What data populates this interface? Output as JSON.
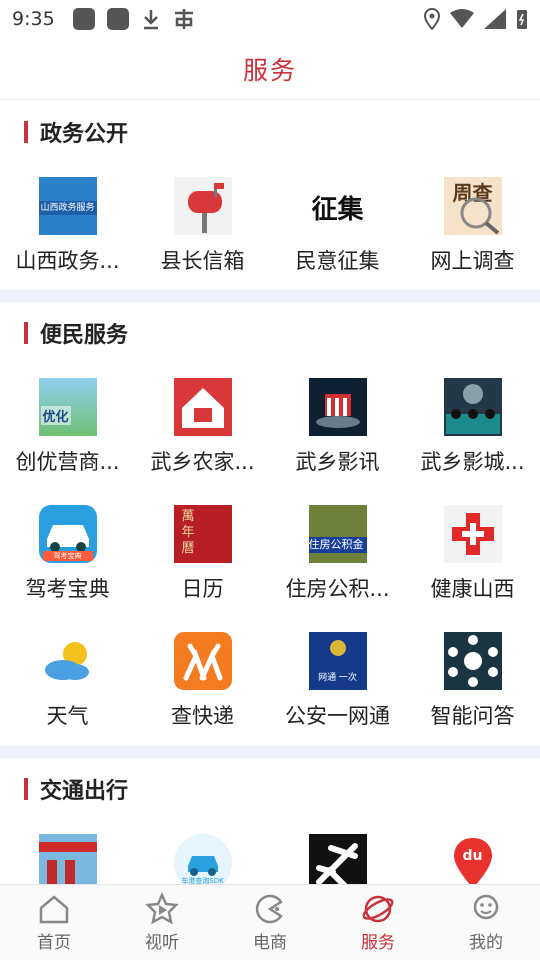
{
  "status": {
    "time": "9:35"
  },
  "header": {
    "title": "服务"
  },
  "sections": [
    {
      "title": "政务公开",
      "items": [
        {
          "label": "山西政务...",
          "icon": "shanxi-gov-icon",
          "art": "山西政务服务"
        },
        {
          "label": "县长信箱",
          "icon": "mailbox-icon"
        },
        {
          "label": "民意征集",
          "icon": "opinion-collect-icon",
          "art": "征集"
        },
        {
          "label": "网上调查",
          "icon": "survey-icon",
          "art": "周查"
        }
      ]
    },
    {
      "title": "便民服务",
      "items": [
        {
          "label": "创优营商...",
          "icon": "business-env-icon",
          "art": "优化"
        },
        {
          "label": "武乡农家...",
          "icon": "farmhouse-icon"
        },
        {
          "label": "武乡影讯",
          "icon": "movie-news-icon"
        },
        {
          "label": "武乡影城...",
          "icon": "cinema-icon"
        },
        {
          "label": "驾考宝典",
          "icon": "driving-test-icon",
          "art": "驾考宝典"
        },
        {
          "label": "日历",
          "icon": "calendar-icon",
          "art": "萬年曆"
        },
        {
          "label": "住房公积...",
          "icon": "housing-fund-icon",
          "art": "住房公积金"
        },
        {
          "label": "健康山西",
          "icon": "health-cross-icon"
        },
        {
          "label": "天气",
          "icon": "weather-icon"
        },
        {
          "label": "查快递",
          "icon": "express-icon"
        },
        {
          "label": "公安一网通",
          "icon": "police-icon",
          "art": "网通 一次"
        },
        {
          "label": "智能问答",
          "icon": "smart-qa-icon"
        }
      ]
    },
    {
      "title": "交通出行",
      "items": [
        {
          "label": "",
          "icon": "gas-station-icon"
        },
        {
          "label": "",
          "icon": "car-service-icon",
          "art": "车港查询SDK"
        },
        {
          "label": "",
          "icon": "airplane-icon"
        },
        {
          "label": "",
          "icon": "baidu-map-icon",
          "art": "du"
        }
      ]
    }
  ],
  "tabbar": [
    {
      "label": "首页",
      "icon": "home-icon"
    },
    {
      "label": "视听",
      "icon": "video-icon"
    },
    {
      "label": "电商",
      "icon": "shop-icon"
    },
    {
      "label": "服务",
      "icon": "service-icon",
      "active": true
    },
    {
      "label": "我的",
      "icon": "profile-icon"
    }
  ],
  "colors": {
    "accent": "#c8323a",
    "divider": "#eef1f7"
  }
}
